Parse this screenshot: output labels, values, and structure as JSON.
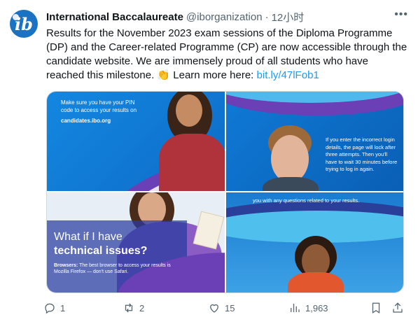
{
  "author": {
    "display_name": "International Baccalaureate",
    "handle": "@iborganization",
    "separator": "·",
    "time": "12小时",
    "avatar_text": "ib"
  },
  "tweet": {
    "text_before_link": "Results for the November 2023 exam sessions of the Diploma Programme (DP) and the Career-related Programme (CP) are now accessible through the candidate website. We are immensely proud of all students who have reached this milestone.",
    "emoji": "👏",
    "text_lead": "Learn more here:",
    "link": "bit.ly/47lFob1"
  },
  "media": {
    "tile1": {
      "line1": "Make sure you have your PIN",
      "line2": "code to access your results on",
      "url": "candidates.ibo.org"
    },
    "tile2": {
      "text": "If you enter the incorrect login details, the page will lock after three attempts. Then you'll have to wait 30 minutes before trying to log in again."
    },
    "tile3": {
      "head1": "What if I have",
      "head2": "technical issues?",
      "body_label": "Browsers:",
      "body": "The best browser to access your results is Mozilla Firefox — don't use Safari."
    },
    "tile4": {
      "text": "you with any questions related to your results."
    }
  },
  "actions": {
    "reply_count": "1",
    "retweet_count": "2",
    "like_count": "15",
    "views_count": "1,963"
  },
  "colors": {
    "link": "#1d9bf0",
    "secondary_text": "#536471",
    "ib_blue": "#0d6cc7"
  }
}
